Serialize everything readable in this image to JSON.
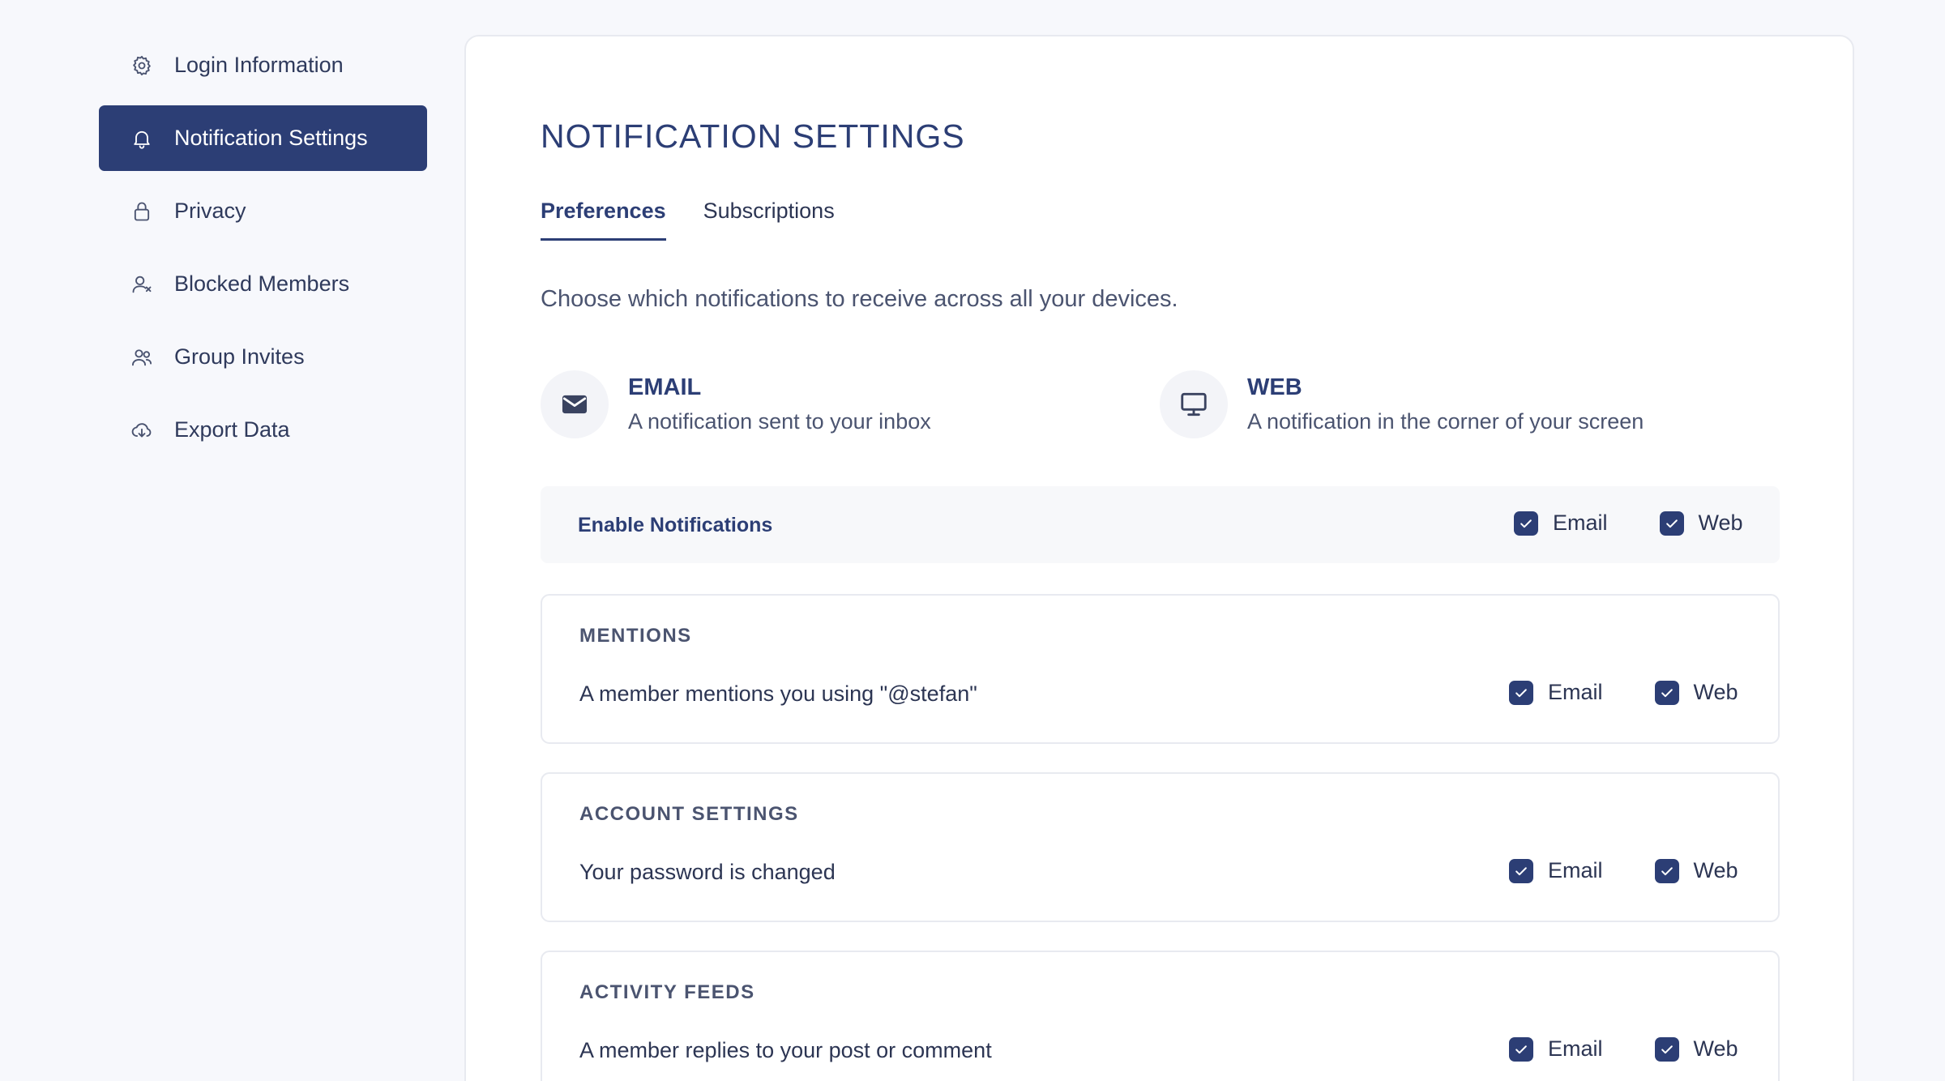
{
  "sidebar": {
    "items": [
      {
        "label": "Login Information",
        "icon": "gear-icon"
      },
      {
        "label": "Notification Settings",
        "icon": "bell-icon",
        "active": true
      },
      {
        "label": "Privacy",
        "icon": "lock-icon"
      },
      {
        "label": "Blocked Members",
        "icon": "user-blocked-icon"
      },
      {
        "label": "Group Invites",
        "icon": "users-icon"
      },
      {
        "label": "Export Data",
        "icon": "cloud-download-icon"
      }
    ]
  },
  "main": {
    "title": "NOTIFICATION SETTINGS",
    "tabs": [
      {
        "label": "Preferences",
        "active": true
      },
      {
        "label": "Subscriptions"
      }
    ],
    "intro": "Choose which notifications to receive across all your devices.",
    "channels": [
      {
        "title": "EMAIL",
        "desc": "A notification sent to your inbox",
        "icon": "envelope-icon"
      },
      {
        "title": "WEB",
        "desc": "A notification in the corner of your screen",
        "icon": "monitor-icon"
      }
    ],
    "enable": {
      "label": "Enable Notifications",
      "email_label": "Email",
      "web_label": "Web",
      "email_checked": true,
      "web_checked": true
    },
    "sections": [
      {
        "title": "MENTIONS",
        "desc": "A member mentions you using \"@stefan\"",
        "email_label": "Email",
        "web_label": "Web",
        "email_checked": true,
        "web_checked": true
      },
      {
        "title": "ACCOUNT SETTINGS",
        "desc": "Your password is changed",
        "email_label": "Email",
        "web_label": "Web",
        "email_checked": true,
        "web_checked": true
      },
      {
        "title": "ACTIVITY FEEDS",
        "desc": "A member replies to your post or comment",
        "email_label": "Email",
        "web_label": "Web",
        "email_checked": true,
        "web_checked": true
      }
    ]
  },
  "colors": {
    "accent": "#2c3e75",
    "background": "#f7f8fc",
    "card": "#ffffff"
  }
}
